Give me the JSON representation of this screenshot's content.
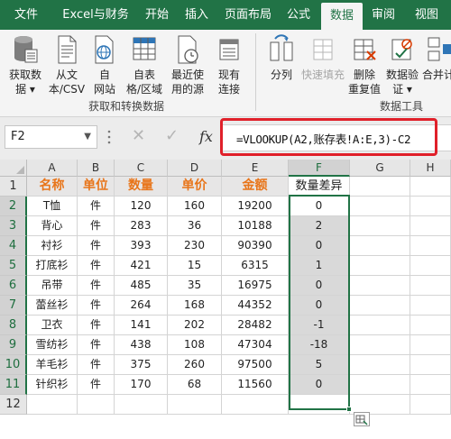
{
  "ribbon_tabs": [
    {
      "label": "文件"
    },
    {
      "label": "Excel与财务"
    },
    {
      "label": "开始"
    },
    {
      "label": "插入"
    },
    {
      "label": "页面布局"
    },
    {
      "label": "公式"
    },
    {
      "label": "数据",
      "active": true
    },
    {
      "label": "审阅"
    },
    {
      "label": "视图"
    }
  ],
  "ribbon": {
    "get_data": {
      "line1": "获取数",
      "line2": "据 ▾"
    },
    "from_text": {
      "line1": "从文",
      "line2": "本/CSV"
    },
    "from_web": {
      "line1": "自",
      "line2": "网站"
    },
    "from_table": {
      "line1": "自表",
      "line2": "格/区域"
    },
    "recent_sources": {
      "line1": "最近使",
      "line2": "用的源"
    },
    "existing_conn": {
      "line1": "现有",
      "line2": "连接"
    },
    "group1_label": "获取和转换数据",
    "text_to_columns": {
      "line1": "分列"
    },
    "flash_fill": {
      "line1": "快速填充"
    },
    "remove_duplicates": {
      "line1": "删除",
      "line2": "重复值"
    },
    "data_validation": {
      "line1": "数据验",
      "line2": "证 ▾"
    },
    "consolidate": {
      "line1": "合并计"
    },
    "group2_label": "数据工具"
  },
  "formula_bar": {
    "name_box": "F2",
    "fx_label": "fx",
    "formula": "=VLOOKUP(A2,账存表!A:E,3)-C2",
    "cancel_symbol": "✕",
    "enter_symbol": "✓"
  },
  "sheet": {
    "columns": [
      "A",
      "B",
      "C",
      "D",
      "E",
      "F",
      "G",
      "H"
    ],
    "rows": [
      "1",
      "2",
      "3",
      "4",
      "5",
      "6",
      "7",
      "8",
      "9",
      "10",
      "11",
      "12"
    ],
    "header": [
      "名称",
      "单位",
      "数量",
      "单价",
      "金额",
      "数量差异"
    ],
    "data": [
      [
        "T恤",
        "件",
        "120",
        "160",
        "19200",
        "0"
      ],
      [
        "背心",
        "件",
        "283",
        "36",
        "10188",
        "2"
      ],
      [
        "衬衫",
        "件",
        "393",
        "230",
        "90390",
        "0"
      ],
      [
        "打底衫",
        "件",
        "421",
        "15",
        "6315",
        "1"
      ],
      [
        "吊带",
        "件",
        "485",
        "35",
        "16975",
        "0"
      ],
      [
        "蕾丝衫",
        "件",
        "264",
        "168",
        "44352",
        "0"
      ],
      [
        "卫衣",
        "件",
        "141",
        "202",
        "28482",
        "-1"
      ],
      [
        "雪纺衫",
        "件",
        "438",
        "108",
        "47304",
        "-18"
      ],
      [
        "羊毛衫",
        "件",
        "375",
        "260",
        "97500",
        "5"
      ],
      [
        "针织衫",
        "件",
        "170",
        "68",
        "11560",
        "0"
      ]
    ],
    "selected_cell": "F2",
    "selected_column": "F",
    "selected_rows": [
      "2",
      "3",
      "4",
      "5",
      "6",
      "7",
      "8",
      "9",
      "10",
      "11"
    ]
  },
  "colors": {
    "accent_green": "#217346",
    "header_text_orange": "#e8751a",
    "highlight_red": "#e0202a"
  }
}
